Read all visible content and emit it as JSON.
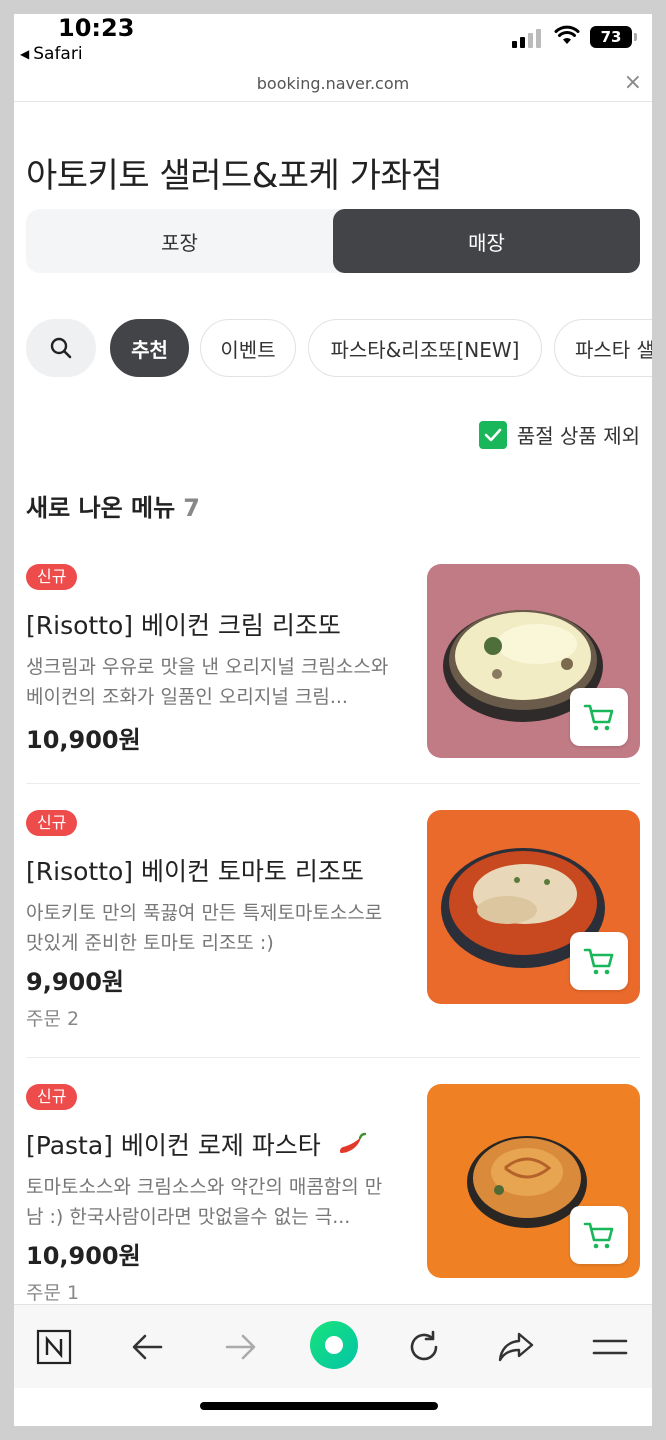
{
  "status_bar": {
    "time": "10:23",
    "back_app": "Safari",
    "battery": "73"
  },
  "url_bar": {
    "url": "booking.naver.com",
    "close": "×"
  },
  "store": {
    "title": "아토키토 샐러드&포케 가좌점"
  },
  "order_type": {
    "takeout": "포장",
    "dine_in": "매장",
    "selected": "매장"
  },
  "categories": [
    "추천",
    "이벤트",
    "파스타&리조또[NEW]",
    "파스타 샐러드"
  ],
  "filter": {
    "exclude_sold_out_label": "품절 상품 제외",
    "checked": true
  },
  "section": {
    "title": "새로 나온 메뉴",
    "count": "7"
  },
  "menu_items": [
    {
      "badge": "신규",
      "name": "[Risotto] 베이컨 크림 리조또",
      "description": "생크림과 우유로 맛을 낸 오리지널 크림소스와 베이컨의 조화가 일품인 오리지널 크림...",
      "price": "10,900원",
      "orders": ""
    },
    {
      "badge": "신규",
      "name": "[Risotto] 베이컨 토마토 리조또",
      "description": "아토키토 만의 푹끓여 만든 특제토마토소스로 맛있게 준비한 토마토 리조또 :)",
      "price": "9,900원",
      "orders": "주문 2"
    },
    {
      "badge": "신규",
      "name": "[Pasta] 베이컨 로제 파스타",
      "description": "토마토소스와 크림소스와 약간의 매콤함의 만남 :) 한국사람이라면 맛없을수 없는 극...",
      "price": "10,900원",
      "orders": "주문 1",
      "spicy": true
    }
  ],
  "colors": {
    "accent_green": "#19b65a",
    "badge_red": "#ee4b4b",
    "dark_chip": "#434447",
    "naver_green": "#03cf5d"
  },
  "toolbar_icons": [
    "naver-n-icon",
    "back-arrow-icon",
    "forward-arrow-icon",
    "naver-green-button-icon",
    "reload-icon",
    "share-icon",
    "menu-icon"
  ]
}
